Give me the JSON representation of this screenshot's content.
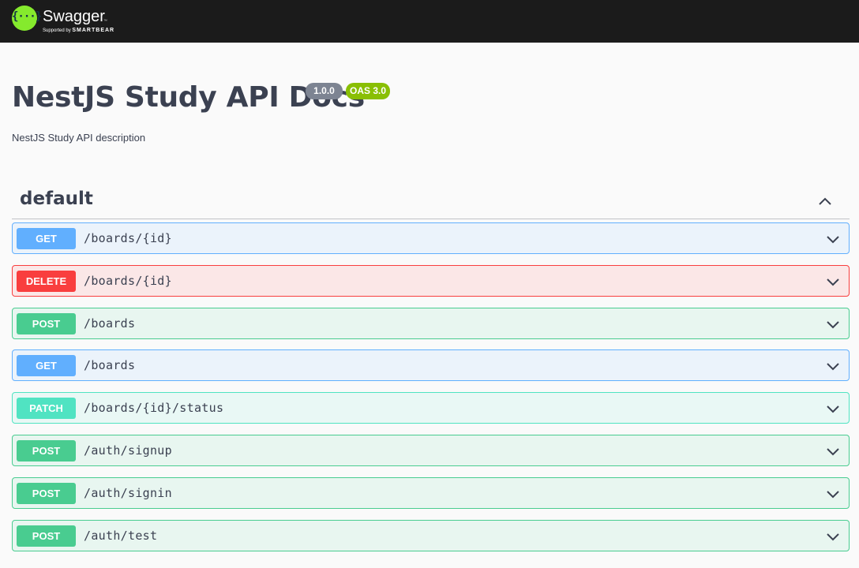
{
  "topbar": {
    "logo_glyph": "{···}",
    "brand": "Swagger",
    "tm": "™",
    "supported_by": "Supported by",
    "company": "SMARTBEAR"
  },
  "info": {
    "title": "NestJS Study API Docs",
    "version": "1.0.0",
    "oas": "OAS 3.0",
    "description": "NestJS Study API description"
  },
  "tag": {
    "name": "default",
    "expanded": true
  },
  "operations": [
    {
      "method": "GET",
      "path": "/boards/{id}"
    },
    {
      "method": "DELETE",
      "path": "/boards/{id}"
    },
    {
      "method": "POST",
      "path": "/boards"
    },
    {
      "method": "GET",
      "path": "/boards"
    },
    {
      "method": "PATCH",
      "path": "/boards/{id}/status"
    },
    {
      "method": "POST",
      "path": "/auth/signup"
    },
    {
      "method": "POST",
      "path": "/auth/signin"
    },
    {
      "method": "POST",
      "path": "/auth/test"
    }
  ],
  "colors": {
    "GET": "#61affe",
    "DELETE": "#f93e3e",
    "POST": "#49cc90",
    "PATCH": "#50e3c2",
    "topbar": "#1b1b1b",
    "logo": "#85ea2d"
  }
}
